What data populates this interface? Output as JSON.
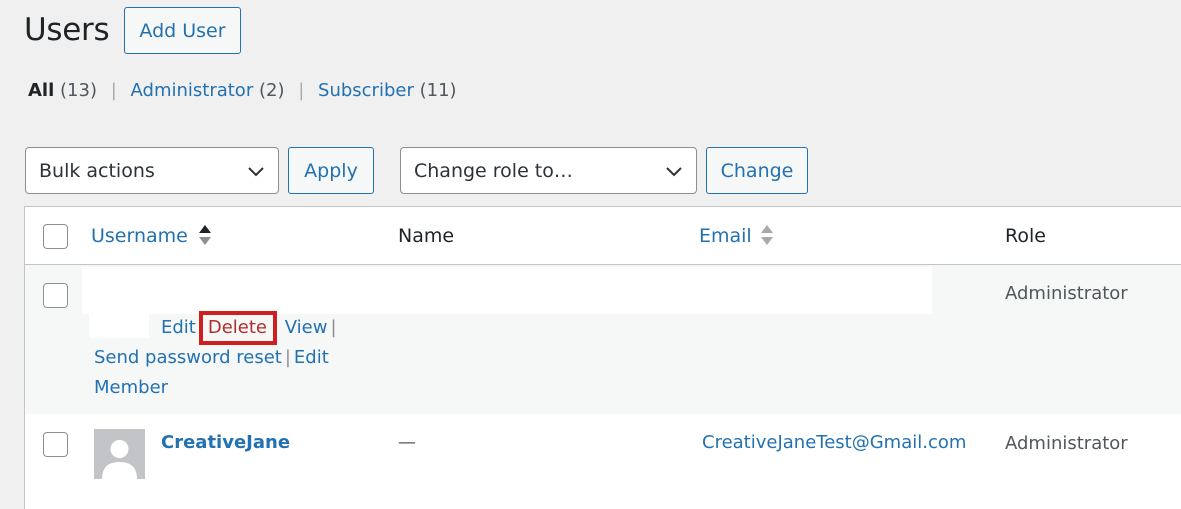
{
  "header": {
    "title": "Users",
    "add_user_label": "Add User"
  },
  "filters": {
    "all_label": "All",
    "all_count": "(13)",
    "admin_label": "Administrator",
    "admin_count": "(2)",
    "subscriber_label": "Subscriber",
    "subscriber_count": "(11)",
    "separator": "|"
  },
  "toolbar": {
    "bulk_actions": "Bulk actions",
    "apply_label": "Apply",
    "change_role": "Change role to…",
    "change_label": "Change"
  },
  "table": {
    "columns": {
      "username": "Username",
      "name": "Name",
      "email": "Email",
      "role": "Role"
    },
    "rows": [
      {
        "role": "Administrator",
        "actions": {
          "edit": "Edit",
          "delete": "Delete",
          "view": "View",
          "send_reset": "Send password reset",
          "edit_member": "Edit",
          "member": "Member",
          "sep": "|"
        }
      },
      {
        "username": "CreativeJane",
        "name": "—",
        "email": "CreativeJaneTest@Gmail.com",
        "role": "Administrator"
      }
    ]
  },
  "colors": {
    "link": "#2271b1",
    "highlight_border": "#d01f1f",
    "delete_text": "#b32d2e"
  }
}
